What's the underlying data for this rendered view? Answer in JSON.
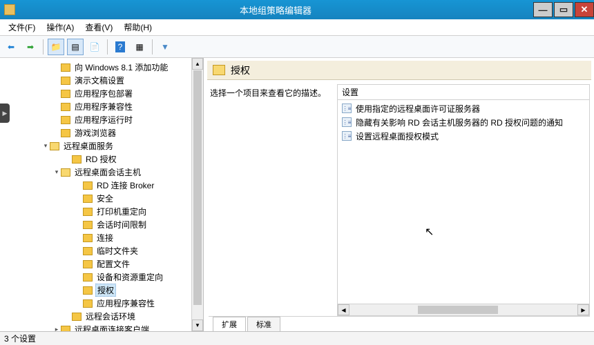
{
  "window": {
    "title": "本地组策略编辑器"
  },
  "menu": {
    "file": "文件(F)",
    "action": "操作(A)",
    "view": "查看(V)",
    "help": "帮助(H)"
  },
  "tree": {
    "items": [
      {
        "indent": 76,
        "exp": "",
        "label": "向 Windows 8.1 添加功能"
      },
      {
        "indent": 76,
        "exp": "",
        "label": "演示文稿设置"
      },
      {
        "indent": 76,
        "exp": "",
        "label": "应用程序包部署"
      },
      {
        "indent": 76,
        "exp": "",
        "label": "应用程序兼容性"
      },
      {
        "indent": 76,
        "exp": "",
        "label": "应用程序运行时"
      },
      {
        "indent": 76,
        "exp": "",
        "label": "游戏浏览器"
      },
      {
        "indent": 60,
        "exp": "▾",
        "label": "远程桌面服务",
        "open": true
      },
      {
        "indent": 92,
        "exp": "",
        "label": "RD 授权"
      },
      {
        "indent": 76,
        "exp": "▾",
        "label": "远程桌面会话主机",
        "open": true
      },
      {
        "indent": 108,
        "exp": "",
        "label": "RD 连接 Broker"
      },
      {
        "indent": 108,
        "exp": "",
        "label": "安全"
      },
      {
        "indent": 108,
        "exp": "",
        "label": "打印机重定向"
      },
      {
        "indent": 108,
        "exp": "",
        "label": "会话时间限制"
      },
      {
        "indent": 108,
        "exp": "",
        "label": "连接"
      },
      {
        "indent": 108,
        "exp": "",
        "label": "临时文件夹"
      },
      {
        "indent": 108,
        "exp": "",
        "label": "配置文件"
      },
      {
        "indent": 108,
        "exp": "",
        "label": "设备和资源重定向"
      },
      {
        "indent": 108,
        "exp": "",
        "label": "授权",
        "selected": true
      },
      {
        "indent": 108,
        "exp": "",
        "label": "应用程序兼容性"
      },
      {
        "indent": 92,
        "exp": "",
        "label": "远程会话环境"
      },
      {
        "indent": 76,
        "exp": "▸",
        "label": "远程桌面连接客户端"
      }
    ]
  },
  "pane": {
    "heading": "授权",
    "desc": "选择一个项目来查看它的描述。",
    "column": "设置",
    "rows": [
      "使用指定的远程桌面许可证服务器",
      "隐藏有关影响 RD 会话主机服务器的 RD 授权问题的通知",
      "设置远程桌面授权模式"
    ]
  },
  "tabs": {
    "extended": "扩展",
    "standard": "标准"
  },
  "status": "3 个设置"
}
